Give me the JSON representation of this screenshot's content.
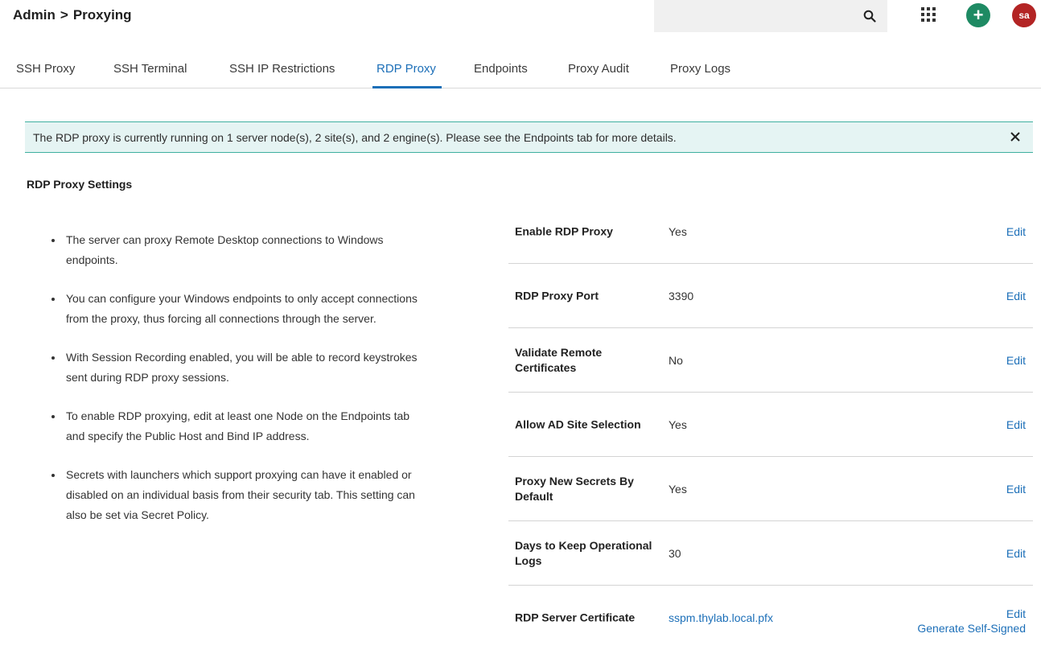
{
  "header": {
    "breadcrumb_root": "Admin",
    "breadcrumb_sep": ">",
    "breadcrumb_current": "Proxying",
    "add_label": "+",
    "avatar_initials": "sa"
  },
  "tabs": [
    {
      "label": "SSH Proxy"
    },
    {
      "label": "SSH Terminal"
    },
    {
      "label": "SSH IP Restrictions"
    },
    {
      "label": "RDP Proxy"
    },
    {
      "label": "Endpoints"
    },
    {
      "label": "Proxy Audit"
    },
    {
      "label": "Proxy Logs"
    }
  ],
  "banner": {
    "text": "The RDP proxy is currently running on 1 server node(s), 2 site(s), and 2 engine(s). Please see the Endpoints tab for more details."
  },
  "section_title": "RDP Proxy Settings",
  "bullets": [
    "The server can proxy Remote Desktop connections to Windows endpoints.",
    "You can configure your Windows endpoints to only accept connections from the proxy, thus forcing all connections through the server.",
    "With Session Recording enabled, you will be able to record keystrokes sent during RDP proxy sessions.",
    "To enable RDP proxying, edit at least one Node on the Endpoints tab and specify the Public Host and Bind IP address.",
    "Secrets with launchers which support proxying can have it enabled or disabled on an individual basis from their security tab. This setting can also be set via Secret Policy."
  ],
  "settings": [
    {
      "label": "Enable RDP Proxy",
      "value": "Yes",
      "edit": "Edit"
    },
    {
      "label": "RDP Proxy Port",
      "value": "3390",
      "edit": "Edit"
    },
    {
      "label": "Validate Remote Certificates",
      "value": "No",
      "edit": "Edit"
    },
    {
      "label": "Allow AD Site Selection",
      "value": "Yes",
      "edit": "Edit"
    },
    {
      "label": "Proxy New Secrets By Default",
      "value": "Yes",
      "edit": "Edit"
    },
    {
      "label": "Days to Keep Operational Logs",
      "value": "30",
      "edit": "Edit"
    },
    {
      "label": "RDP Server Certificate",
      "value": "sspm.thylab.local.pfx",
      "edit": "Edit",
      "generate": "Generate Self-Signed"
    }
  ],
  "colors": {
    "accent": "#1c6fb8",
    "add_button": "#1e8a63",
    "avatar": "#b32424",
    "banner_bg": "#e5f4f3",
    "banner_border": "#3fb0a0"
  },
  "icons": {
    "search": "search-icon",
    "apps": "apps-grid-icon",
    "close": "close-icon"
  }
}
